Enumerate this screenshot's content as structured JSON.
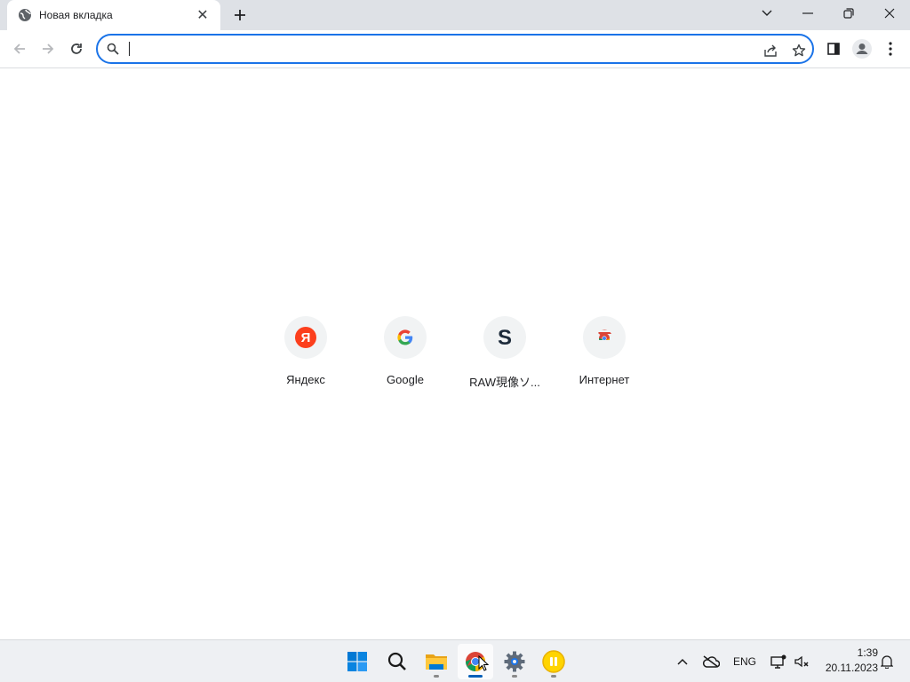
{
  "tab": {
    "title": "Новая вкладка",
    "close_glyph": "✕",
    "favicon": "globe-icon"
  },
  "newtab": {
    "icon": "plus-icon"
  },
  "window": {
    "icons": [
      "chevron-down-icon",
      "minimize-icon",
      "restore-icon",
      "close-icon"
    ]
  },
  "toolbar": {
    "icons": [
      "back-icon",
      "forward-icon",
      "reload-icon",
      "side-panel-icon",
      "profile-icon",
      "kebab-menu-icon"
    ]
  },
  "omnibox": {
    "value": "",
    "placeholder": "",
    "icons": [
      "search-icon",
      "share-icon",
      "star-icon"
    ]
  },
  "shortcuts": [
    {
      "label": "Яндекс",
      "icon": "yandex-icon",
      "glyph": "Я",
      "color": "#fc3f1d"
    },
    {
      "label": "Google",
      "icon": "google-icon",
      "glyph": "G",
      "color": "#4285f4"
    },
    {
      "label": "RAW現像ソ...",
      "icon": "silkypix-icon",
      "glyph": "S",
      "color": "#1c2a3a"
    },
    {
      "label": "Интернет",
      "icon": "chrome-icon",
      "glyph": "",
      "color": "#db4437"
    }
  ],
  "taskbar": {
    "apps": [
      "windows-start-icon",
      "search-icon",
      "file-explorer-icon",
      "chrome-icon",
      "settings-icon",
      "media-player-icon"
    ],
    "tray": {
      "chevron": "^",
      "lang": "ENG",
      "icons": [
        "cloud-offline-icon",
        "network-icon",
        "volume-muted-icon",
        "notification-bell-icon"
      ]
    },
    "time": "1:39",
    "date": "20.11.2023"
  },
  "colors": {
    "accent": "#1a73e8",
    "tabstrip": "#dee1e6",
    "taskbar": "#eef0f3"
  }
}
